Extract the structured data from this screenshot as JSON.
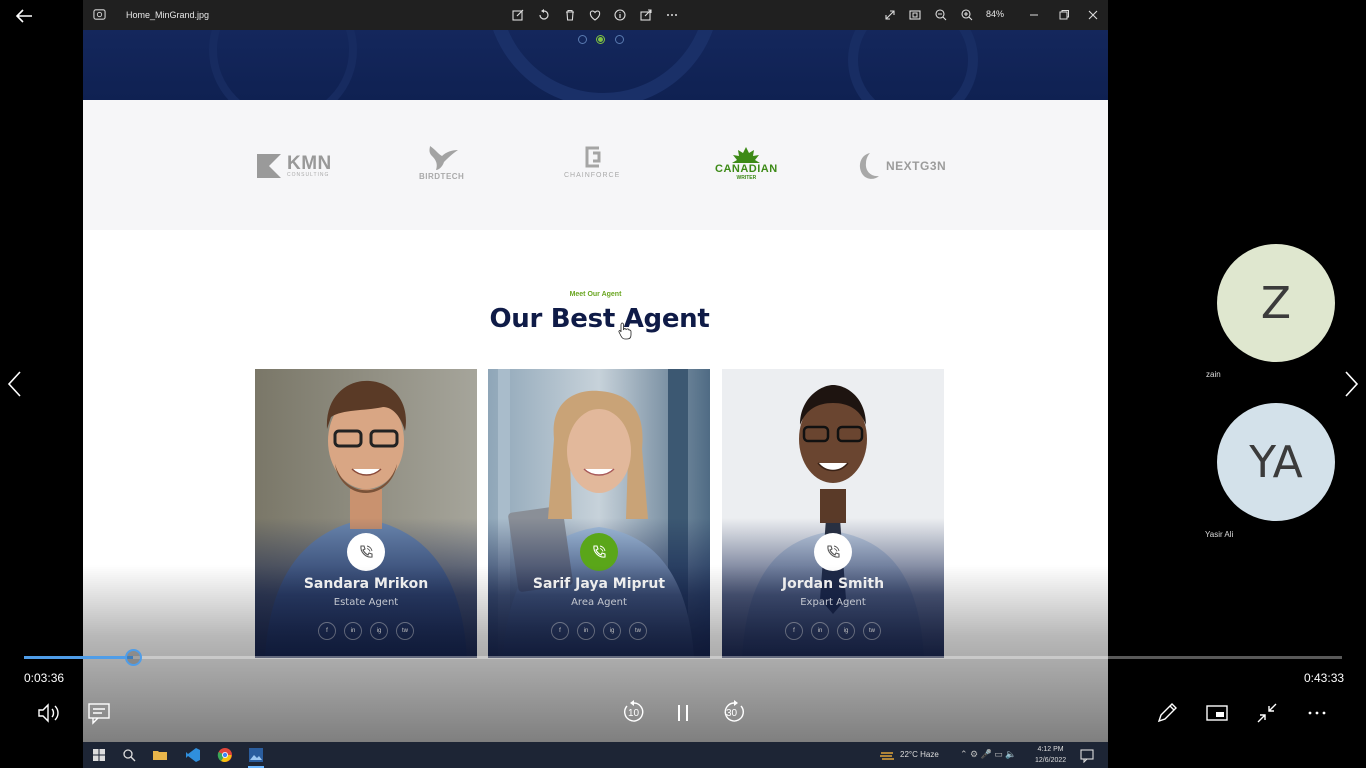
{
  "photos_app": {
    "file_name": "Home_MinGrand.jpg",
    "zoom": "84%",
    "toolbar_icons": [
      "edit-icon",
      "rotate-icon",
      "delete-icon",
      "favorite-icon",
      "info-icon",
      "share-icon",
      "more-icon"
    ],
    "right_icons": [
      "expand-icon",
      "slideshow-icon",
      "zoom-out-icon",
      "zoom-in-icon"
    ]
  },
  "website": {
    "carousel_dots": 3,
    "carousel_active_index": 1,
    "logos": [
      {
        "name": "KMN",
        "sub": "CONSULTING"
      },
      {
        "name": "BIRDTECH",
        "sub": ""
      },
      {
        "name": "CHAINFORCE",
        "sub": ""
      },
      {
        "name": "CANADIAN",
        "sub": "WRITER"
      },
      {
        "name": "NEXTG3N",
        "sub": ""
      }
    ],
    "eyebrow": "Meet Our Agent",
    "title": "Our Best Agent",
    "agents": [
      {
        "name": "Sandara Mrikon",
        "role": "Estate Agent"
      },
      {
        "name": "Sarif Jaya Miprut",
        "role": "Area Agent"
      },
      {
        "name": "Jordan Smith",
        "role": "Expart Agent"
      }
    ],
    "social_labels": [
      "f",
      "in",
      "ig",
      "tw"
    ],
    "colors": {
      "navy": "#0f1b47",
      "green": "#5aa619"
    }
  },
  "taskbar": {
    "weather": "22°C  Haze",
    "time": "4:12 PM",
    "date": "12/6/2022"
  },
  "participants": [
    {
      "initials": "Z",
      "name": "zain",
      "color": "#dfe7cf"
    },
    {
      "initials": "YA",
      "name": "Yasir Ali",
      "color": "#d3e1ea"
    }
  ],
  "player": {
    "current_time": "0:03:36",
    "total_time": "0:43:33",
    "progress": 0.083,
    "rewind_label": "10",
    "forward_label": "30"
  }
}
